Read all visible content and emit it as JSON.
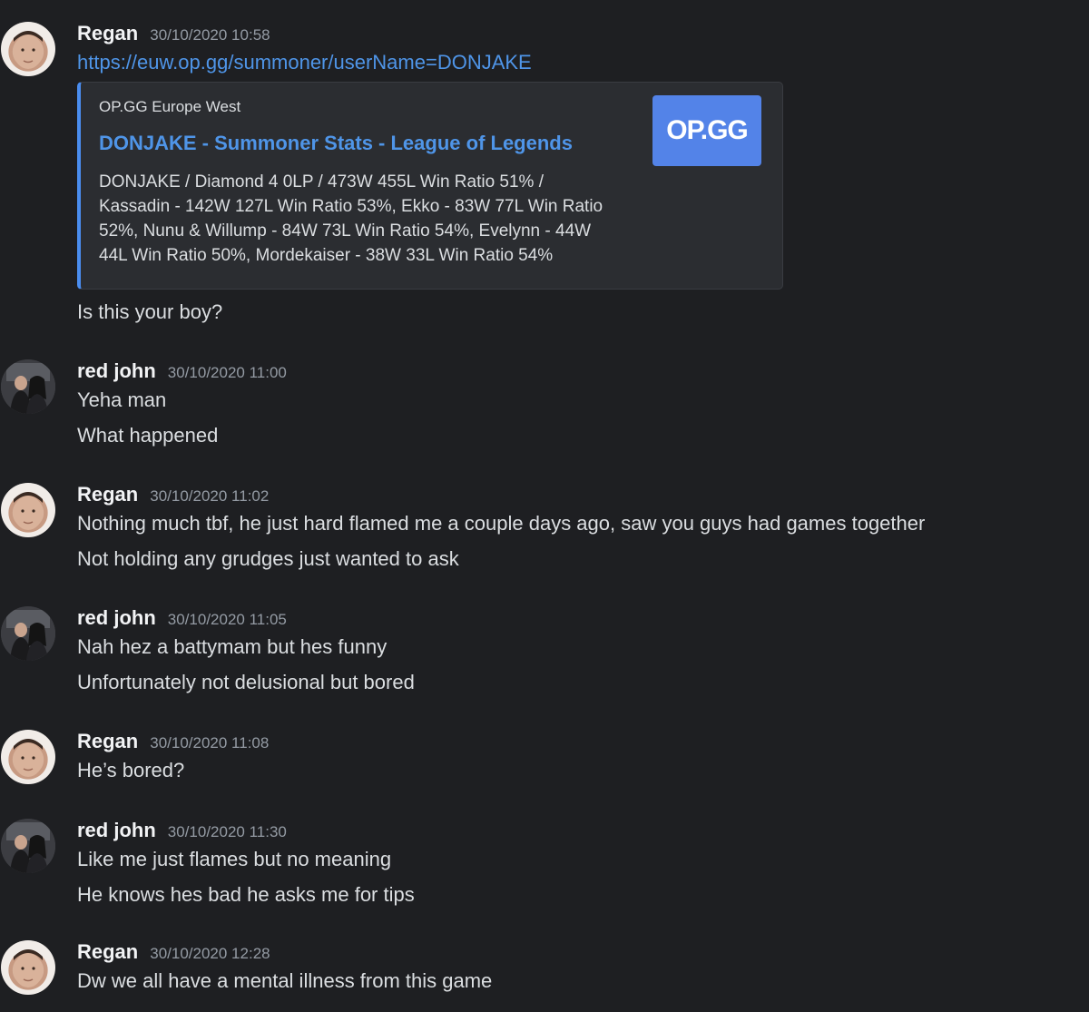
{
  "messages": [
    {
      "author": "Regan",
      "timestamp": "30/10/2020 10:58",
      "link": "https://euw.op.gg/summoner/userName=DONJAKE",
      "embed": {
        "provider": "OP.GG Europe West",
        "title": "DONJAKE - Summoner Stats - League of Legends",
        "description_lines": [
          "DONJAKE / Diamond 4 0LP / 473W 455L Win Ratio 51% /",
          "Kassadin - 142W 127L Win Ratio 53%, Ekko - 83W 77L Win Ratio",
          "52%, Nunu & Willump - 84W 73L Win Ratio 54%, Evelynn - 44W",
          "44L Win Ratio 50%, Mordekaiser - 38W 33L Win Ratio 54%"
        ],
        "thumbnail_text": "OP.GG"
      },
      "lines": [
        "Is this your boy?"
      ]
    },
    {
      "author": "red john",
      "timestamp": "30/10/2020 11:00",
      "lines": [
        "Yeha man",
        "What happened"
      ]
    },
    {
      "author": "Regan",
      "timestamp": "30/10/2020 11:02",
      "lines": [
        "Nothing much tbf, he just hard flamed me a couple days ago, saw you guys had games together",
        "Not holding any grudges just wanted to ask"
      ]
    },
    {
      "author": "red john",
      "timestamp": "30/10/2020 11:05",
      "lines": [
        "Nah hez a battymam but hes funny",
        "Unfortunately not delusional but bored"
      ]
    },
    {
      "author": "Regan",
      "timestamp": "30/10/2020 11:08",
      "lines": [
        "He’s bored?"
      ]
    },
    {
      "author": "red john",
      "timestamp": "30/10/2020 11:30",
      "lines": [
        "Like me just flames but no meaning",
        "He knows hes bad he asks me for tips"
      ]
    },
    {
      "author": "Regan",
      "timestamp": "30/10/2020 12:28",
      "lines": [
        "Dw we all have a mental illness from this game"
      ]
    }
  ]
}
